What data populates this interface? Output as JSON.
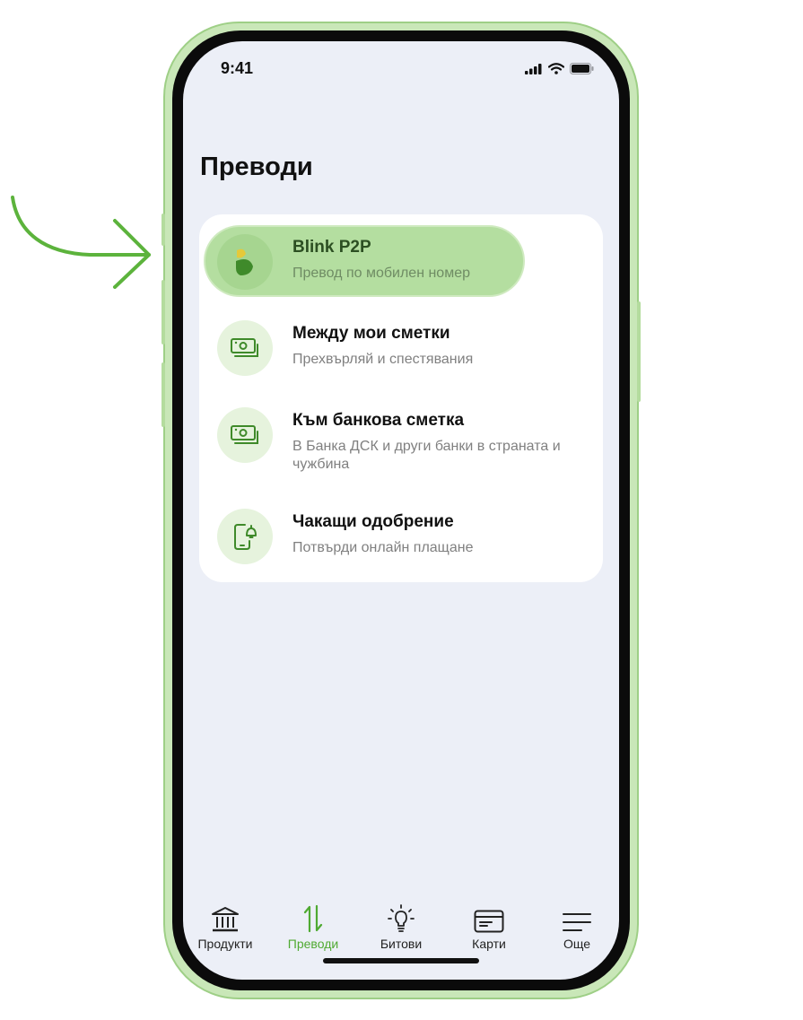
{
  "status": {
    "time": "9:41"
  },
  "page": {
    "title": "Преводи"
  },
  "transfers": [
    {
      "title": "Blink P2P",
      "subtitle": "Превод по мобилен номер",
      "icon": "blink-logo-icon"
    },
    {
      "title": "Между мои сметки",
      "subtitle": "Прехвърляй и спестявания",
      "icon": "money-icon"
    },
    {
      "title": "Към банкова сметка",
      "subtitle": "В Банка ДСК и други банки в страната и чужбина",
      "icon": "money-icon"
    },
    {
      "title": "Чакащи одобрение",
      "subtitle": "Потвърди онлайн плащане",
      "icon": "phone-bell-icon"
    }
  ],
  "tabs": [
    {
      "label": "Продукти",
      "icon": "bank-icon",
      "active": false
    },
    {
      "label": "Преводи",
      "icon": "transfer-arrows-icon",
      "active": true
    },
    {
      "label": "Битови",
      "icon": "lightbulb-icon",
      "active": false
    },
    {
      "label": "Карти",
      "icon": "card-icon",
      "active": false
    },
    {
      "label": "Още",
      "icon": "menu-icon",
      "active": false
    }
  ],
  "colors": {
    "accent": "#4faa32",
    "highlight": "#b4dea0",
    "screen_bg": "#eceff7"
  }
}
